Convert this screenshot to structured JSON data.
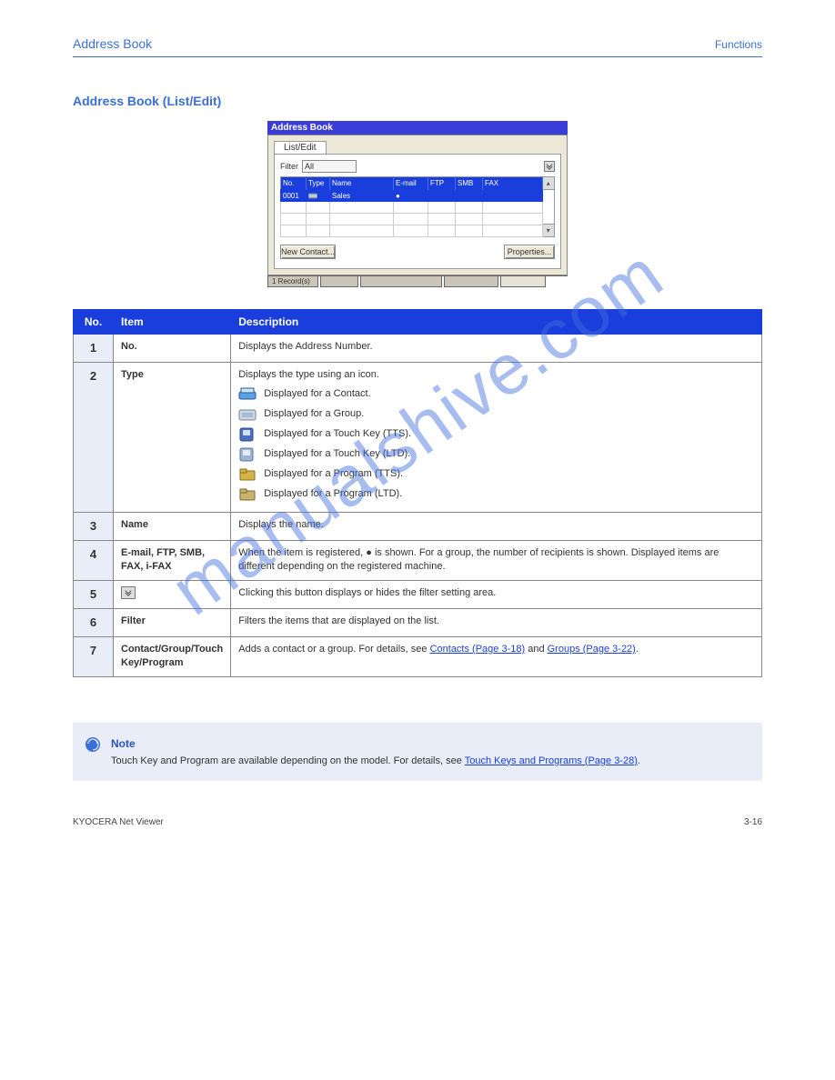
{
  "header": {
    "left": "Address Book",
    "right": "Functions"
  },
  "section_title": "Address Book (List/Edit)",
  "dialog": {
    "title": "Address Book",
    "tab": "List/Edit",
    "filter_label": "Filter",
    "filter_value": "All",
    "chev": "≫",
    "columns": [
      "No.",
      "Type",
      "Name",
      "E-mail",
      "FTP",
      "SMB",
      "FAX"
    ],
    "row": {
      "no": "0001",
      "type": "",
      "name": "Sales",
      "email": "",
      "ftp": "",
      "smb": "",
      "fax": ""
    },
    "buttons": {
      "new": "New Contact...",
      "properties": "Properties..."
    },
    "status": {
      "counts": "1 Record(s)",
      "slot1": "",
      "slot2": "",
      "slot3": "",
      "slot4": ""
    }
  },
  "desc": {
    "head": {
      "no": "No.",
      "item": "Item",
      "description": "Description"
    },
    "rows": [
      {
        "no": "1",
        "item": "No.",
        "description": "Displays the Address Number."
      },
      {
        "no": "2",
        "item": "Type",
        "description_intro": "Displays the type using an icon.",
        "icons": [
          {
            "name": "scanner-icon",
            "label": "Displayed for a Contact.",
            "fill": "#5aa0e6"
          },
          {
            "name": "group-icon",
            "label": "Displayed for a Group.",
            "fill": "#8fb5d6"
          },
          {
            "name": "touch-tts-icon",
            "label": "Displayed for a Touch Key (TTS).",
            "fill": "#4a6fbf"
          },
          {
            "name": "touch-ltd-icon",
            "label": "Displayed for a Touch Key (LTD).",
            "fill": "#6e91c7"
          },
          {
            "name": "program-tts-icon",
            "label": "Displayed for a Program (TTS).",
            "fill": "#c7a23a"
          },
          {
            "name": "program-ltd-icon",
            "label": "Displayed for a Program (LTD).",
            "fill": "#b4963a"
          }
        ]
      },
      {
        "no": "3",
        "item": "Name",
        "description": "Displays the name."
      },
      {
        "no": "4",
        "item": "E-mail, FTP, SMB, FAX, i-FAX",
        "description": "When the item is registered, ● is shown. For a group, the number of recipients is shown. Displayed items are different depending on the registered machine."
      },
      {
        "no": "5",
        "item_icon": "≫",
        "description": "Clicking this button displays or hides the filter setting area."
      },
      {
        "no": "6",
        "item": "Filter",
        "description": "Filters the items that are displayed on the list."
      },
      {
        "no": "7",
        "item": "Contact/Group/Touch Key/Program",
        "description_pre": "Adds a contact or a group. For details, see ",
        "link1": "Contacts (Page 3-18)",
        "between": " and ",
        "link2": "Groups (Page 3-22)",
        "after": "."
      }
    ]
  },
  "note": {
    "title": "Note",
    "body_pre": "Touch Key and Program are available depending on the model. For details, see ",
    "link": "Touch Keys and Programs (Page 3-28)",
    "after": "."
  },
  "footer": {
    "left": "KYOCERA Net Viewer",
    "right": "3-16"
  },
  "watermark": "manualshive.com"
}
